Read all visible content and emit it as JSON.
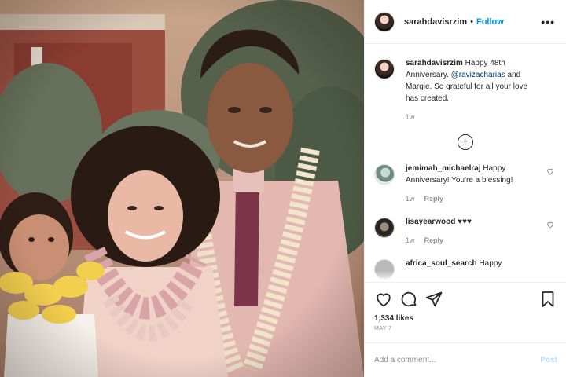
{
  "post": {
    "author": "sarahdavisrzim",
    "separator": "•",
    "follow_label": "Follow",
    "more_label": "•••"
  },
  "comments": [
    {
      "user": "sarahdavisrzim",
      "parts": [
        "Happy 48th Anniversary. ",
        "@ravizacharias",
        " and Margie. So grateful for all your love has created."
      ],
      "time": "1w",
      "reply": ""
    },
    {
      "user": "jemimah_michaelraj",
      "text": "Happy Anniversary! You're a blessing!",
      "time": "1w",
      "reply": "Reply"
    },
    {
      "user": "lisayearwood",
      "text": "♥♥♥",
      "time": "1w",
      "reply": "Reply"
    },
    {
      "user": "africa_soul_search",
      "text": "Happy"
    }
  ],
  "load_more_symbol": "+",
  "likes": "1,334 likes",
  "date": "MAY 7",
  "add_comment": {
    "placeholder": "Add a comment...",
    "post_label": "Post"
  },
  "icons": {
    "like": "heart-icon",
    "comment": "comment-bubble-icon",
    "share": "paper-plane-icon",
    "save": "bookmark-icon",
    "load_more": "plus-circle-icon"
  }
}
